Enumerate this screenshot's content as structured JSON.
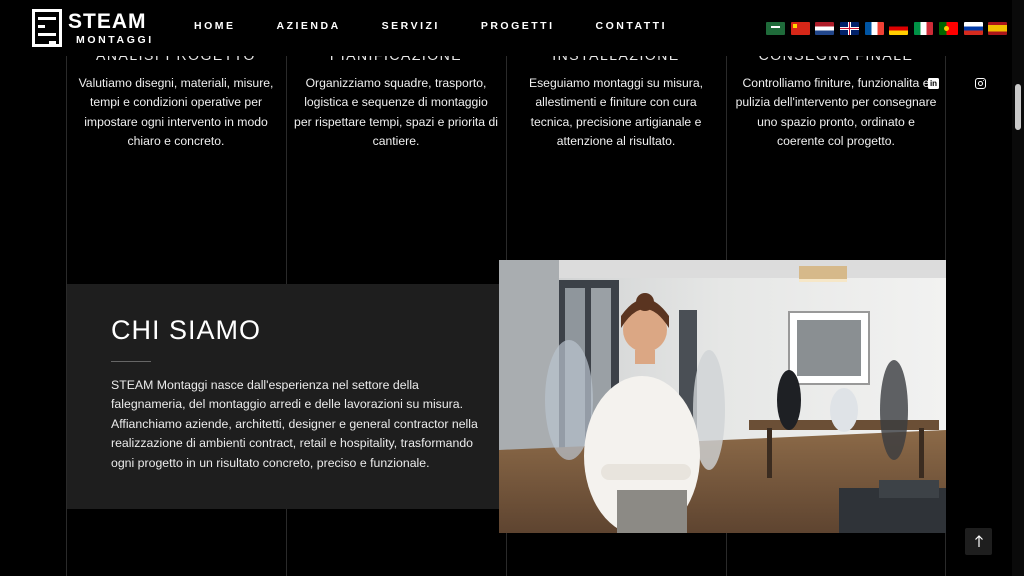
{
  "brand": {
    "name": "STEAM",
    "sub": "MONTAGGI"
  },
  "nav": [
    "HOME",
    "AZIENDA",
    "SERVIZI",
    "PROGETTI",
    "CONTATTI"
  ],
  "languages": [
    "ar",
    "zh",
    "nl",
    "en",
    "fr",
    "de",
    "it",
    "pt",
    "ru",
    "es"
  ],
  "services": [
    {
      "title": "ANALISI PROGETTO",
      "text": "Valutiamo disegni, materiali, misure, tempi e condizioni operative per impostare ogni intervento in modo chiaro e concreto."
    },
    {
      "title": "PIANIFICAZIONE",
      "text": "Organizziamo squadre, trasporto, logistica e sequenze di montaggio per rispettare tempi, spazi e priorita di cantiere."
    },
    {
      "title": "INSTALLAZIONE",
      "text": "Eseguiamo montaggi su misura, allestimenti e finiture con cura tecnica, precisione artigianale e attenzione al risultato."
    },
    {
      "title": "CONSEGNA FINALE",
      "text": "Controlliamo finiture, funzionalita e pulizia dell'intervento per consegnare uno spazio pronto, ordinato e coerente col progetto."
    }
  ],
  "social": [
    "linkedin-icon",
    "instagram-icon"
  ],
  "about": {
    "title": "CHI SIAMO",
    "text": "STEAM Montaggi nasce dall'esperienza nel settore della falegnameria, del montaggio arredi e delle lavorazioni su misura. Affianchiamo aziende, architetti, designer e general contractor nella realizzazione di ambienti contract, retail e hospitality, trasformando ogni progetto in un risultato concreto, preciso e funzionale."
  },
  "back_to_top": "↑",
  "colors": {
    "background": "#000000",
    "card": "#1e1e1e",
    "text": "#ffffff",
    "divider": "#2a2a2a"
  }
}
